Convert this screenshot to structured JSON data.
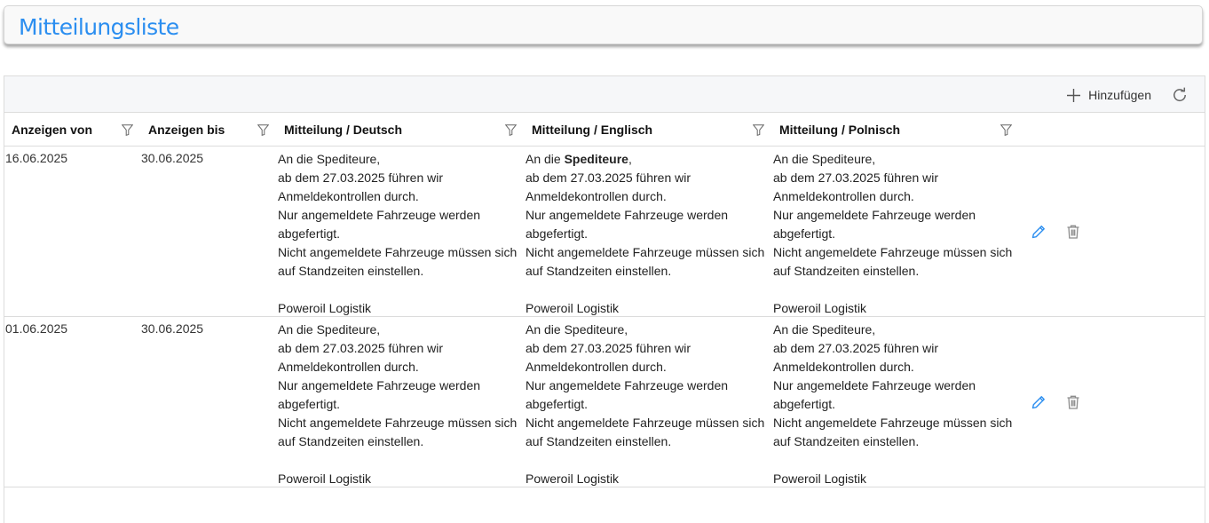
{
  "page": {
    "title": "Mitteilungsliste"
  },
  "toolbar": {
    "add_label": "Hinzufügen"
  },
  "columns": [
    {
      "label": "Anzeigen von"
    },
    {
      "label": "Anzeigen bis"
    },
    {
      "label": "Mitteilung / Deutsch"
    },
    {
      "label": "Mitteilung / Englisch"
    },
    {
      "label": "Mitteilung / Polnisch"
    }
  ],
  "rows": [
    {
      "from": "16.06.2025",
      "to": "30.06.2025",
      "de": "An die Spediteure,\nab dem 27.03.2025 führen wir\nAnmeldekontrollen durch.\nNur angemeldete Fahrzeuge werden\nabgefertigt.\nNicht angemeldete Fahrzeuge müssen sich\nauf Standzeiten einstellen.\n\nPoweroil Logistik",
      "en_prefix": "An die ",
      "en_bold": "Spediteure",
      "en_rest": ",\nab dem 27.03.2025 führen wir\nAnmeldekontrollen durch.\nNur angemeldete Fahrzeuge werden\nabgefertigt.\nNicht angemeldete Fahrzeuge müssen sich\nauf Standzeiten einstellen.\n\nPoweroil Logistik",
      "pl": "An die Spediteure,\nab dem 27.03.2025 führen wir\nAnmeldekontrollen durch.\nNur angemeldete Fahrzeuge werden\nabgefertigt.\nNicht angemeldete Fahrzeuge müssen sich\nauf Standzeiten einstellen.\n\nPoweroil Logistik"
    },
    {
      "from": "01.06.2025",
      "to": "30.06.2025",
      "de": "An die Spediteure,\nab dem 27.03.2025 führen wir\nAnmeldekontrollen durch.\nNur angemeldete Fahrzeuge werden\nabgefertigt.\nNicht angemeldete Fahrzeuge müssen sich\nauf Standzeiten einstellen.\n\nPoweroil Logistik",
      "en_prefix": "",
      "en_bold": "",
      "en_rest": "An die Spediteure,\nab dem 27.03.2025 führen wir\nAnmeldekontrollen durch.\nNur angemeldete Fahrzeuge werden\nabgefertigt.\nNicht angemeldete Fahrzeuge müssen sich\nauf Standzeiten einstellen.\n\nPoweroil Logistik",
      "pl": "An die Spediteure,\nab dem 27.03.2025 führen wir\nAnmeldekontrollen durch.\nNur angemeldete Fahrzeuge werden\nabgefertigt.\nNicht angemeldete Fahrzeuge müssen sich\nauf Standzeiten einstellen.\n\nPoweroil Logistik"
    }
  ],
  "icons": {
    "add": "plus-icon",
    "refresh": "refresh-icon",
    "filter": "filter-icon",
    "edit": "pencil-icon",
    "delete": "trash-icon"
  },
  "colors": {
    "title": "#2b8ef0",
    "edit_icon": "#2b8ef0",
    "delete_icon": "#8c8c8c"
  }
}
